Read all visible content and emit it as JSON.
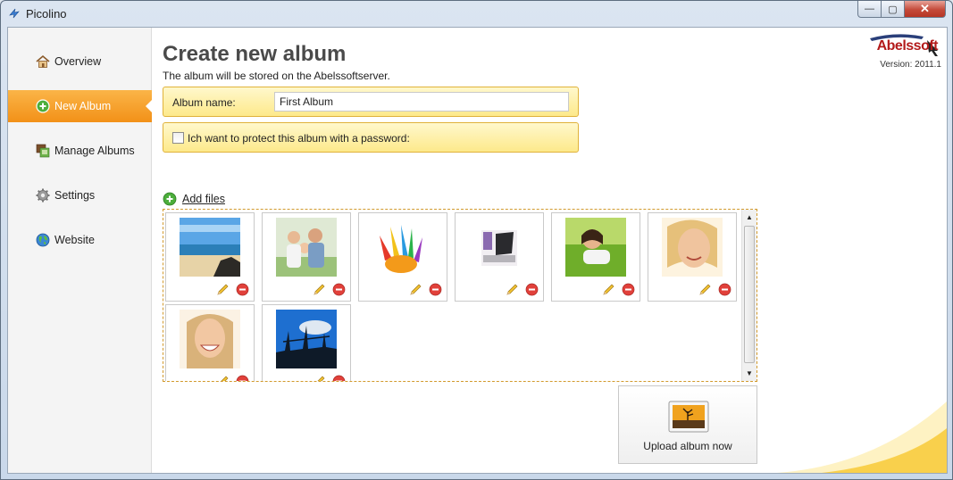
{
  "window": {
    "title": "Picolino",
    "buttons": {
      "minimize": "—",
      "maximize": "▢",
      "close": "✕"
    }
  },
  "sidebar": {
    "items": [
      {
        "label": "Overview",
        "icon": "home-icon",
        "active": false
      },
      {
        "label": "New Album",
        "icon": "add-circle-icon",
        "active": true
      },
      {
        "label": "Manage Albums",
        "icon": "albums-icon",
        "active": false
      },
      {
        "label": "Settings",
        "icon": "gear-icon",
        "active": false
      },
      {
        "label": "Website",
        "icon": "globe-icon",
        "active": false
      }
    ]
  },
  "main": {
    "heading": "Create new album",
    "subtitle": "The album will be stored on the Abelssoftserver.",
    "brand": {
      "logo_text": "Abelssoft",
      "version": "Version: 2011.1",
      "color": "#b31b1b"
    },
    "album_name": {
      "label": "Album name:",
      "value": "First Album"
    },
    "password": {
      "label": "Ich want to protect this album with a password:",
      "checked": false
    },
    "add_files": {
      "label": "Add files",
      "icon": "add-circle-icon"
    },
    "photos": [
      {
        "subject": "beach"
      },
      {
        "subject": "family"
      },
      {
        "subject": "painted-hands"
      },
      {
        "subject": "laptop"
      },
      {
        "subject": "woman-on-grass"
      },
      {
        "subject": "smiling-woman"
      },
      {
        "subject": "laughing-woman"
      },
      {
        "subject": "industrial-sky"
      }
    ],
    "upload": {
      "label": "Upload album now",
      "icon": "photo-icon"
    },
    "accent_color": "#f29118"
  }
}
